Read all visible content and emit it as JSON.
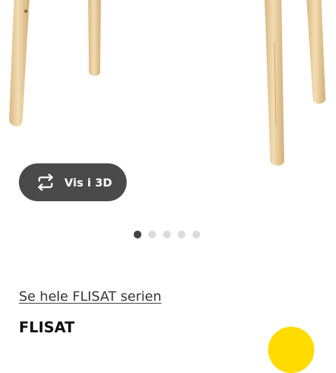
{
  "product": {
    "view_3d_label": "Vis i 3D",
    "series_link": "Se hele FLISAT serien",
    "name": "FLISAT"
  },
  "carousel": {
    "total_dots": 5,
    "active_index": 0
  },
  "icons": {
    "view_3d": "rotate-3d-icon"
  },
  "colors": {
    "button_bg": "#4a4a4a",
    "dot_active": "#444444",
    "dot_inactive": "#dcdcdc",
    "accent_yellow": "#ffdb00",
    "wood": "#e9cf9e"
  }
}
